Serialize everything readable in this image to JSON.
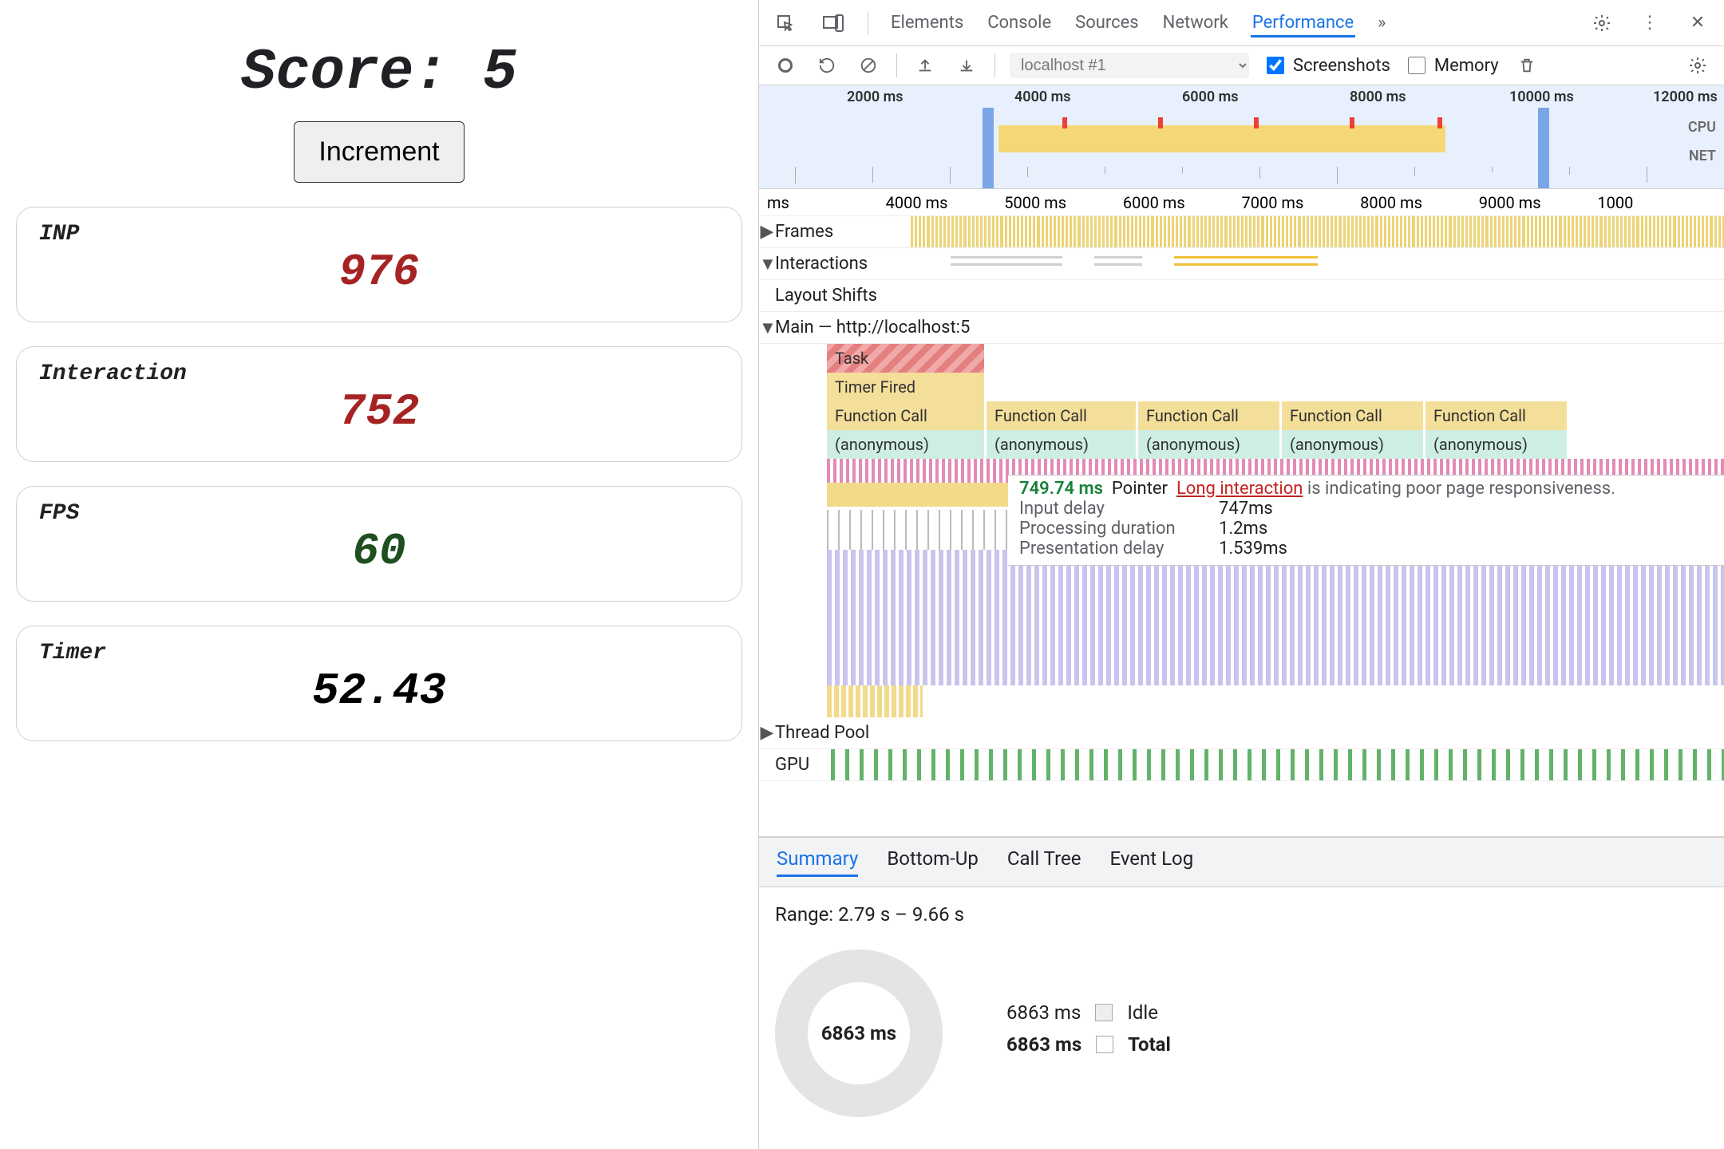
{
  "page": {
    "score_label": "Score: ",
    "score_value": "5",
    "increment_label": "Increment",
    "cards": {
      "inp": {
        "label": "INP",
        "value": "976",
        "color": "red"
      },
      "interaction": {
        "label": "Interaction",
        "value": "752",
        "color": "red"
      },
      "fps": {
        "label": "FPS",
        "value": "60",
        "color": "green"
      },
      "timer": {
        "label": "Timer",
        "value": "52.43",
        "color": "black"
      }
    }
  },
  "devtools": {
    "tabs": [
      "Elements",
      "Console",
      "Sources",
      "Network",
      "Performance"
    ],
    "tabs_active": "Performance",
    "more_tabs": "»",
    "toolbar": {
      "profile": "localhost #1",
      "screenshots": "Screenshots",
      "memory": "Memory"
    },
    "overview": {
      "ticks": [
        "2000 ms",
        "4000 ms",
        "6000 ms",
        "8000 ms",
        "10000 ms",
        "12000 ms"
      ],
      "cpu_label": "CPU",
      "net_label": "NET"
    },
    "ruler": [
      "ms",
      "4000 ms",
      "5000 ms",
      "6000 ms",
      "7000 ms",
      "8000 ms",
      "9000 ms",
      "1000"
    ],
    "tracks": {
      "frames": "Frames",
      "interactions": "Interactions",
      "layout_shifts": "Layout Shifts",
      "main": "Main — http://localhost:5",
      "thread_pool": "Thread Pool",
      "gpu": "GPU"
    },
    "tooltip": {
      "duration": "749.74 ms",
      "pointer": "Pointer",
      "link": "Long interaction",
      "warn": " is indicating poor page responsiveness.",
      "input_delay_label": "Input delay",
      "input_delay_value": "747ms",
      "proc_label": "Processing duration",
      "proc_value": "1.2ms",
      "pres_label": "Presentation delay",
      "pres_value": "1.539ms"
    },
    "flame": {
      "task": "Task",
      "timer": "Timer Fired",
      "fn": "Function Call",
      "anon": "(anonymous)"
    },
    "bottom": {
      "tabs": [
        "Summary",
        "Bottom-Up",
        "Call Tree",
        "Event Log"
      ],
      "active": "Summary",
      "range": "Range: 2.79 s – 9.66 s",
      "donut": "6863 ms",
      "legend": {
        "idle_time": "6863 ms",
        "idle_label": "Idle",
        "total_time": "6863 ms",
        "total_label": "Total"
      }
    }
  }
}
